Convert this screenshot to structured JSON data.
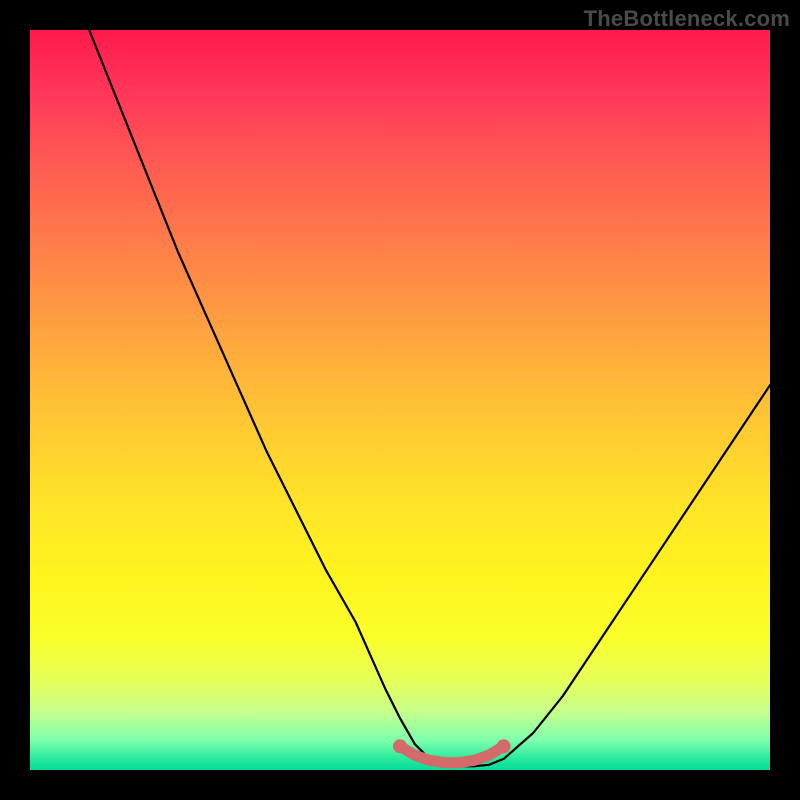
{
  "watermark": "TheBottleneck.com",
  "chart_data": {
    "type": "line",
    "title": "",
    "xlabel": "",
    "ylabel": "",
    "xlim": [
      0,
      100
    ],
    "ylim": [
      0,
      100
    ],
    "grid": false,
    "legend": false,
    "series": [
      {
        "name": "bottleneck-curve",
        "x": [
          8,
          12,
          16,
          20,
          24,
          28,
          32,
          36,
          40,
          44,
          48,
          50,
          52,
          54,
          56,
          58,
          60,
          62,
          64,
          68,
          72,
          76,
          80,
          84,
          88,
          92,
          96,
          100
        ],
        "y": [
          100,
          90,
          80,
          70,
          61,
          52,
          43,
          35,
          27,
          20,
          11,
          7,
          3.5,
          1.5,
          0.7,
          0.5,
          0.5,
          0.7,
          1.5,
          5,
          10,
          16,
          22,
          28,
          34,
          40,
          46,
          52
        ]
      },
      {
        "name": "optimal-zone",
        "x": [
          50,
          52,
          54,
          56,
          58,
          60,
          62,
          64
        ],
        "y": [
          3.2,
          2.0,
          1.3,
          1.0,
          1.0,
          1.3,
          2.0,
          3.2
        ]
      }
    ],
    "gradient_stops": [
      {
        "pos": 0,
        "color": "#ff1a4d"
      },
      {
        "pos": 18,
        "color": "#ff5a52"
      },
      {
        "pos": 38,
        "color": "#ff9a42"
      },
      {
        "pos": 58,
        "color": "#ffd52e"
      },
      {
        "pos": 82,
        "color": "#faff2a"
      },
      {
        "pos": 96,
        "color": "#7dffac"
      },
      {
        "pos": 100,
        "color": "#09dba0"
      }
    ]
  }
}
